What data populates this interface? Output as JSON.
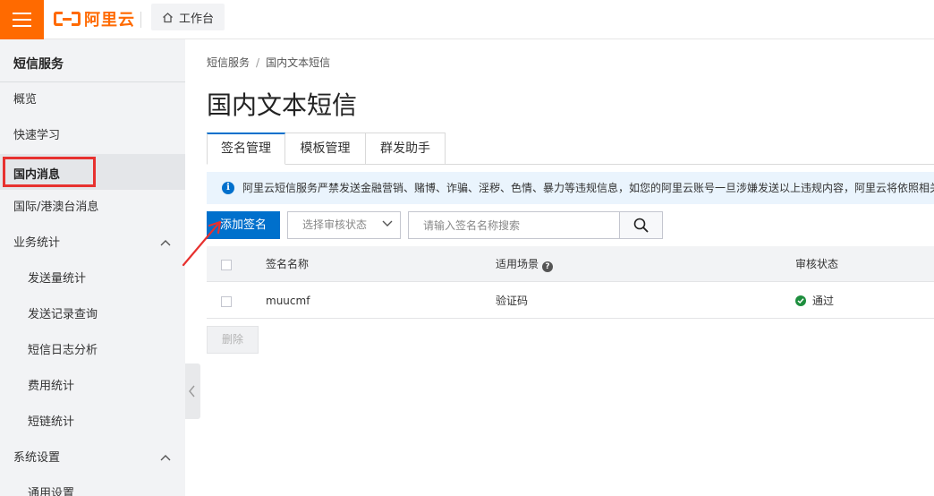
{
  "topbar": {
    "brand": "阿里云",
    "workbench_label": "工作台"
  },
  "sidebar": {
    "title": "短信服务",
    "items": [
      {
        "label": "概览"
      },
      {
        "label": "快速学习"
      },
      {
        "label": "国内消息",
        "active": true
      },
      {
        "label": "国际/港澳台消息"
      },
      {
        "label": "业务统计",
        "expanded": true
      },
      {
        "label": "发送量统计"
      },
      {
        "label": "发送记录查询"
      },
      {
        "label": "短信日志分析"
      },
      {
        "label": "费用统计"
      },
      {
        "label": "短链统计"
      },
      {
        "label": "系统设置",
        "expanded": true
      },
      {
        "label": "通用设置"
      }
    ]
  },
  "breadcrumb": {
    "items": [
      "短信服务",
      "国内文本短信"
    ],
    "separator": "/"
  },
  "page": {
    "title": "国内文本短信"
  },
  "tabs": [
    {
      "label": "签名管理",
      "active": true
    },
    {
      "label": "模板管理"
    },
    {
      "label": "群发助手"
    }
  ],
  "notice": {
    "text": "阿里云短信服务严禁发送金融营销、赌博、诈骗、淫秽、色情、暴力等违规信息，如您的阿里云账号一旦涉嫌发送以上违规内容，阿里云将依照相关法"
  },
  "toolbar": {
    "add_label": "添加签名",
    "status_select_placeholder": "选择审核状态",
    "search_placeholder": "请输入签名名称搜索"
  },
  "table": {
    "columns": [
      "签名名称",
      "适用场景",
      "审核状态"
    ],
    "rows": [
      {
        "name": "muucmf",
        "scene": "验证码",
        "status": "通过"
      }
    ]
  },
  "footer": {
    "delete_label": "删除"
  },
  "colors": {
    "brand_orange": "#ff6a00",
    "primary_blue": "#0070cc",
    "annotation_red": "#e7312f",
    "success_green": "#1e8e3e"
  }
}
